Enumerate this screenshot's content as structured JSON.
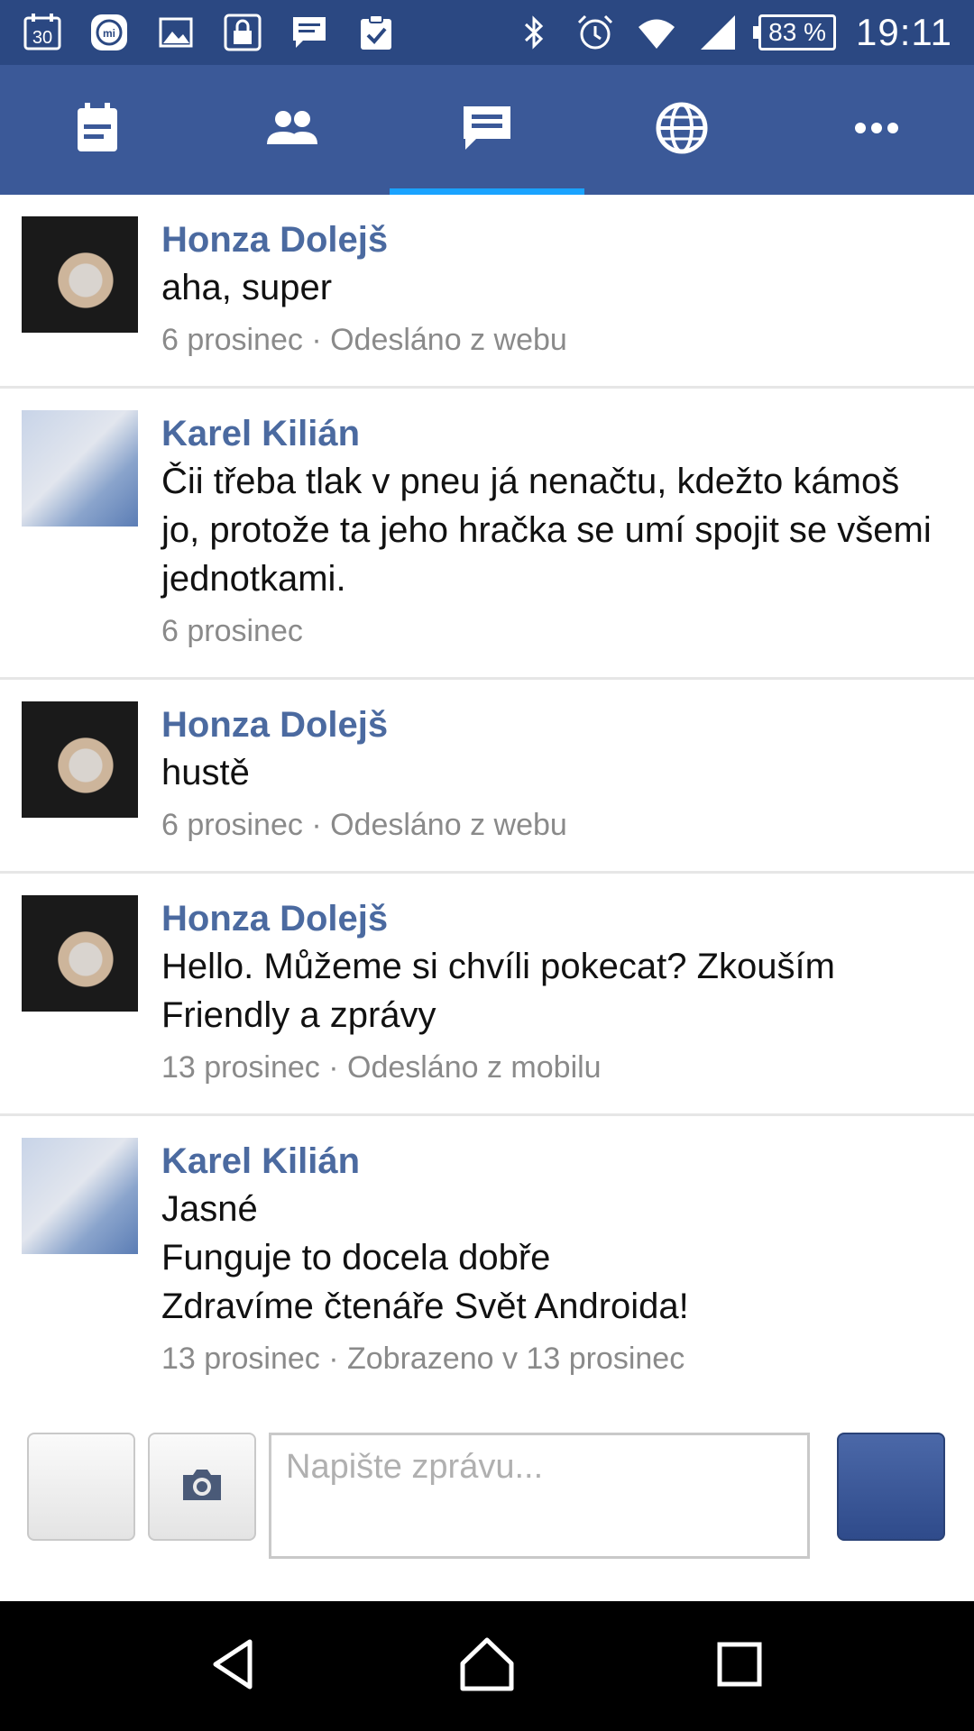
{
  "status_bar": {
    "notifications": [
      "calendar-30-icon",
      "mi-icon",
      "image-icon",
      "lock-icon",
      "message-icon",
      "clipboard-check-icon"
    ],
    "battery": "83 %",
    "time": "19:11"
  },
  "nav": {
    "tabs": [
      {
        "icon": "feed-icon",
        "active": false
      },
      {
        "icon": "friends-icon",
        "active": false
      },
      {
        "icon": "messages-icon",
        "active": true
      },
      {
        "icon": "globe-icon",
        "active": false
      },
      {
        "icon": "more-icon",
        "active": false
      }
    ]
  },
  "messages": [
    {
      "author": "Honza Dolejš",
      "avatar": "honza",
      "text": "aha, super",
      "meta": "6 prosinec · Odesláno z webu"
    },
    {
      "author": "Karel Kilián",
      "avatar": "karel",
      "text": "Čii třeba tlak v pneu já nenačtu, kdežto kámoš jo, protože ta jeho hračka se umí spojit se všemi jednotkami.",
      "meta": "6 prosinec"
    },
    {
      "author": "Honza Dolejš",
      "avatar": "honza",
      "text": "hustě",
      "meta": "6 prosinec · Odesláno z webu"
    },
    {
      "author": "Honza Dolejš",
      "avatar": "honza",
      "text": "Hello. Můžeme si chvíli pokecat? Zkouším Friendly a zprávy",
      "meta": "13 prosinec · Odesláno z mobilu"
    },
    {
      "author": "Karel Kilián",
      "avatar": "karel",
      "text_lines": [
        "Jasné",
        "Funguje to docela dobře",
        "Zdravíme čtenáře Svět Androida!"
      ],
      "meta": "13 prosinec · Zobrazeno v 13 prosinec"
    }
  ],
  "composer": {
    "placeholder": "Napište zprávu..."
  }
}
